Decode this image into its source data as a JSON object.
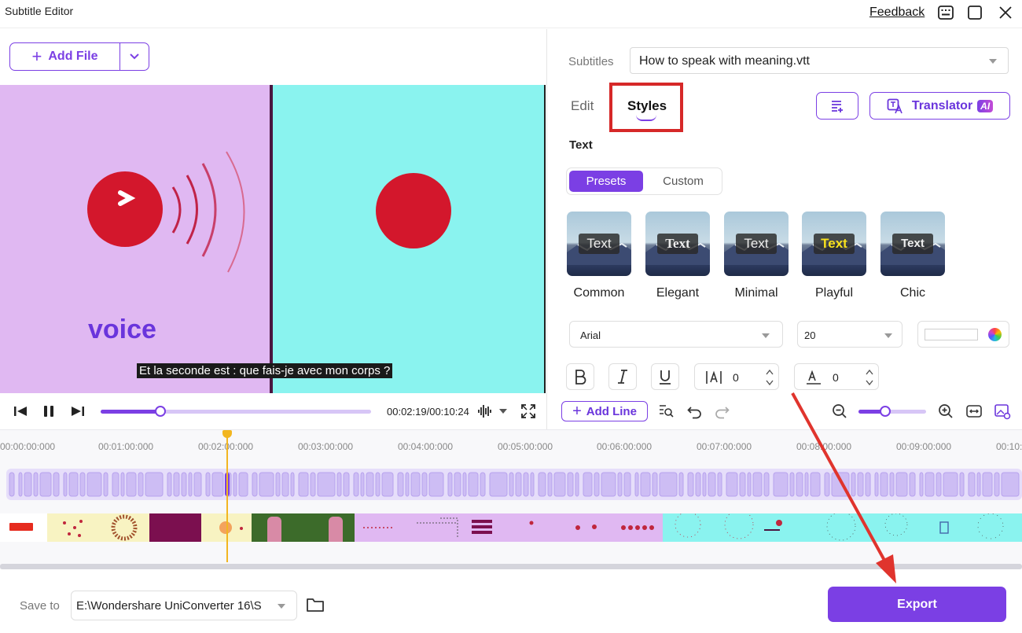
{
  "window": {
    "title": "Subtitle Editor",
    "feedback_label": "Feedback"
  },
  "left": {
    "add_file_label": "Add File",
    "preview": {
      "overlay_word": "voice",
      "subtitle_text": "Et la seconde est : que fais-je avec mon corps ?"
    },
    "player": {
      "time": "00:02:19/00:10:24",
      "progress_fraction": 0.22
    }
  },
  "right": {
    "subtitles_label": "Subtitles",
    "subtitles_file": "How to speak with meaning.vtt",
    "tabs": {
      "edit": "Edit",
      "styles": "Styles"
    },
    "translator_label": "Translator",
    "ai_badge": "AI",
    "section_title": "Text",
    "mode_toggle": {
      "presets": "Presets",
      "custom": "Custom",
      "active": "presets"
    },
    "presets": [
      {
        "label": "Common",
        "sample": "Text",
        "color": "#eeeeee"
      },
      {
        "label": "Elegant",
        "sample": "Text",
        "color": "#ffffff"
      },
      {
        "label": "Minimal",
        "sample": "Text",
        "color": "#ffffff"
      },
      {
        "label": "Playful",
        "sample": "Text",
        "color": "#f7e11d"
      },
      {
        "label": "Chic",
        "sample": "Text",
        "color": "#ffffff"
      }
    ],
    "font_family": "Arial",
    "font_size": "20",
    "char_spacing": "0",
    "line_spacing": "0",
    "add_line_label": "Add Line",
    "zoom_fraction": 0.4
  },
  "timeline": {
    "ticks": [
      "00:00:00:000",
      "00:01:00:000",
      "00:02:00:000",
      "00:03:00:000",
      "00:04:00:000",
      "00:05:00:000",
      "00:06:00:000",
      "00:07:00:000",
      "00:08:00:000",
      "00:09:00:000",
      "00:10:"
    ]
  },
  "bottom": {
    "save_to_label": "Save to",
    "save_path": "E:\\Wondershare UniConverter 16\\S",
    "export_label": "Export"
  },
  "colors": {
    "accent": "#7b3fe4",
    "highlight_box": "#d62828",
    "preview_left_bg": "#e0b8f2",
    "preview_right_bg": "#8af3ef",
    "dot_red": "#d3172c"
  }
}
